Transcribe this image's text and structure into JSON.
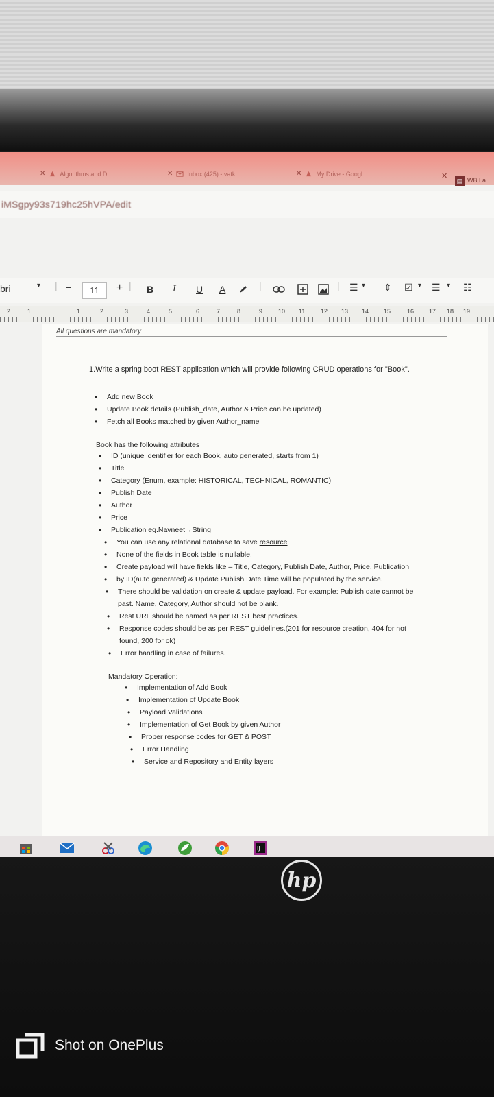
{
  "browser": {
    "tabs": [
      {
        "label": "Algorithms and D"
      },
      {
        "label": "Inbox (425) - vatk"
      },
      {
        "label": "My Drive - Googl"
      }
    ],
    "extra_tab_label": "WB La",
    "address": "iMSgpy93s719hc25hVPA/edit"
  },
  "toolbar": {
    "font_name": "bri",
    "font_size": "11",
    "minus": "−",
    "plus": "+",
    "bold": "B",
    "italic": "I",
    "underline": "U",
    "text_color": "A"
  },
  "ruler": {
    "numbers": [
      "2",
      "1",
      "1",
      "2",
      "3",
      "4",
      "5",
      "6",
      "7",
      "8",
      "9",
      "10",
      "11",
      "12",
      "13",
      "14",
      "15",
      "16",
      "17",
      "18",
      "19"
    ]
  },
  "document": {
    "note": "All questions are mandatory",
    "title": "1.Write a spring boot REST application which will provide following CRUD operations for \"Book\".",
    "operations": [
      "Add new Book",
      "Update Book details (Publish_date, Author & Price can be updated)",
      "Fetch all Books matched by given Author_name"
    ],
    "attributes_heading": "Book has the following attributes",
    "attributes": [
      "ID (unique identifier for each Book, auto generated, starts from 1)",
      "Title",
      "Category (Enum, example: HISTORICAL, TECHNICAL, ROMANTIC)",
      "Publish Date",
      "Author",
      "Price",
      "Publication eg.Navneet→String"
    ],
    "rules_1_prefix": "You can use any relational database to save ",
    "rules_1_link": "resource",
    "rules_2": "None of the fields in Book table is nullable.",
    "rules_3": "Create payload will have fields like – Title, Category, Publish Date, Author, Price, Publication",
    "rules_4": "by ID(auto generated) & Update Publish Date Time will be populated by the service.",
    "rules_5": "There should be validation on create & update payload. For example: Publish date cannot be",
    "rules_5b": "past. Name, Category, Author should not be blank.",
    "rules_6": "Rest URL should be named as per REST best practices.",
    "rules_7": "Response codes should be as per REST guidelines.(201 for resource creation, 404 for not",
    "rules_7b": "found, 200 for ok)",
    "rules_8": "Error handling in case of failures.",
    "mandatory_heading": "Mandatory Operation:",
    "mandatory": [
      "Implementation of Add Book",
      "Implementation of Update Book",
      "Payload Validations",
      "Implementation of Get Book by given Author",
      "Proper response codes for GET & POST",
      "Error Handling",
      "Service and Repository and Entity layers"
    ]
  },
  "camera": {
    "brand": "hp",
    "watermark": "Shot on OnePlus"
  },
  "colors": {
    "tab_strip": "#f08f86",
    "page": "#fbfbf8",
    "bezel": "#141414"
  }
}
